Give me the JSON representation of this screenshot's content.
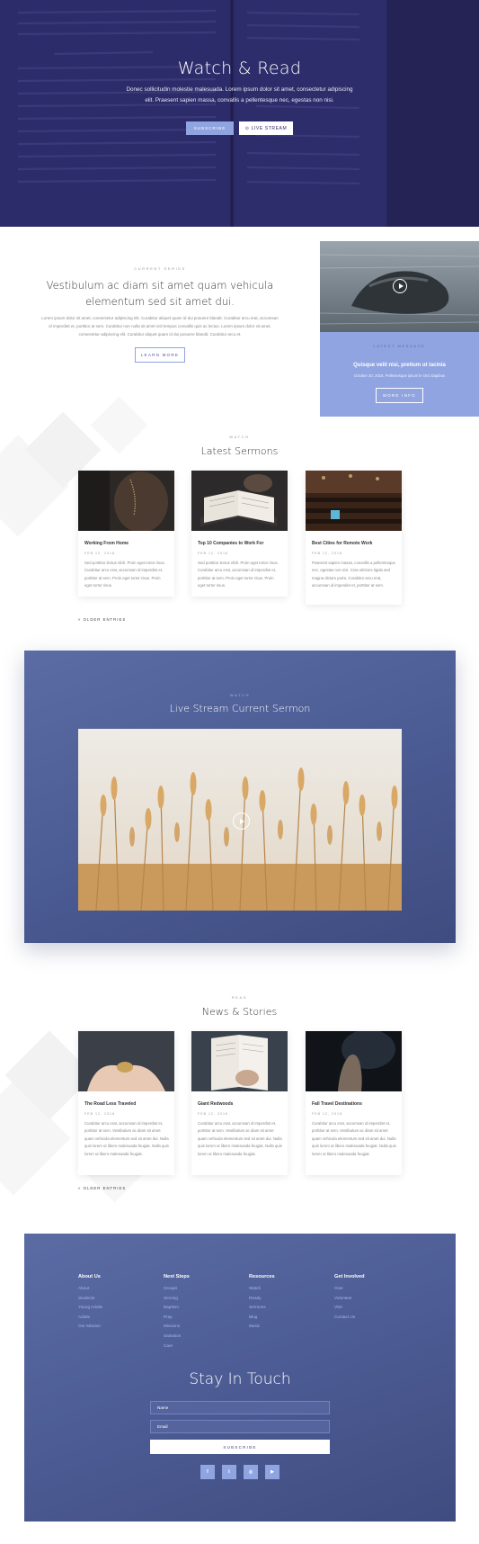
{
  "hero": {
    "title": "Watch & Read",
    "text": "Donec sollicitudin molestie malesuada. Lorem ipsum dolor sit amet, consectetur adipiscing elit. Praesent sapien massa, convallis a pellentesque nec, egestas non nisi.",
    "subscribe_label": "SUBSCRIBE",
    "live_label": "LIVE STREAM",
    "bg_color": "#2b2a66"
  },
  "series": {
    "eyebrow": "CURRENT SERIES",
    "title": "Vestibulum ac diam sit amet quam vehicula elementum sed sit amet dui.",
    "text": "Lorem ipsum dolor sit amet, consectetur adipiscing elit. Curabitur aliquet quam id dui posuere blandit. Curabitur arcu erat, accumsan id imperdiet et, porttitor at sem. Curabitur non nulla sit amet nisl tempus convallis quis ac lectus. Lorem ipsum dolor sit amet, consectetur adipiscing elit. Curabitur aliquet quam id dui posuere blandit. Curabitur arcu et.",
    "button_label": "LEARN MORE"
  },
  "latest_message": {
    "eyebrow": "LATEST MESSAGE",
    "title": "Quisque velit nisi, pretium ut lacinia",
    "subtitle": "October 20, 2018, Pellentesque ipsum le Orci Dapibus",
    "button_label": "MORE INFO",
    "accent": "#8fa4e0"
  },
  "sermons": {
    "eyebrow": "WATCH",
    "title": "Latest Sermons",
    "older_label": "« OLDER ENTRIES",
    "cards": [
      {
        "title": "Working From Home",
        "date": "FEB 12, 2018",
        "text": "Sed porttitor lectus nibh. Proin eget tortor risus. Curabitur arcu erat, accumsan id imperdiet et, porttitor at sem. Proin eget tortor risus. Proin eget tortor risus."
      },
      {
        "title": "Top 10 Companies to Work For",
        "date": "FEB 12, 2018",
        "text": "Sed porttitor lectus nibh. Proin eget tortor risus. Curabitur arcu erat, accumsan id imperdiet et, porttitor at sem. Proin eget tortor risus. Proin eget tortor risus."
      },
      {
        "title": "Best Cities for Remote Work",
        "date": "FEB 12, 2018",
        "text": "Praesent sapien massa, convallis a pellentesque nec, egestas non nisi. Cras ultricies ligula sed magna dictum porta. Curabitur arcu erat, accumsan id imperdiet et, porttitor at sem."
      }
    ]
  },
  "live": {
    "eyebrow": "WATCH",
    "title": "Live Stream Current Sermon"
  },
  "news": {
    "eyebrow": "READ",
    "title": "News & Stories",
    "older_label": "« OLDER ENTRIES",
    "cards": [
      {
        "title": "The Road Less Traveled",
        "date": "FEB 12, 2018",
        "text": "Curabitur arcu erat, accumsan id imperdiet et, porttitor at sem. Vestibulum ac diam sit amet quam vehicula elementum sed sit amet dui. Nulla quis lorem ut libero malesuada feugiat. Nulla quis lorem ut libero malesuada feugiat."
      },
      {
        "title": "Giant Redwoods",
        "date": "FEB 12, 2018",
        "text": "Curabitur arcu erat, accumsan id imperdiet et, porttitor at sem. Vestibulum ac diam sit amet quam vehicula elementum sed sit amet dui. Nulla quis lorem ut libero malesuada feugiat. Nulla quis lorem ut libero malesuada feugiat."
      },
      {
        "title": "Fall Travel Destinations",
        "date": "FEB 12, 2018",
        "text": "Curabitur arcu erat, accumsan id imperdiet et, porttitor at sem. Vestibulum ac diam sit amet quam vehicula elementum sed sit amet dui. Nulla quis lorem ut libero malesuada feugiat. Nulla quis lorem ut libero malesuada feugiat."
      }
    ]
  },
  "footer": {
    "columns": [
      {
        "title": "About Us",
        "items": [
          "About",
          "Students",
          "Young Adults",
          "Adults",
          "Our Mission"
        ]
      },
      {
        "title": "Next Steps",
        "items": [
          "Groups",
          "Serving",
          "Baptism",
          "Pray",
          "Missions",
          "Salvation",
          "Care"
        ]
      },
      {
        "title": "Resources",
        "items": [
          "Watch",
          "Ready",
          "Sermons",
          "Blog",
          "Music"
        ]
      },
      {
        "title": "Get Involved",
        "items": [
          "Give",
          "Volunteer",
          "Visit",
          "Contact Us"
        ]
      }
    ],
    "stay_title": "Stay In Touch",
    "name_placeholder": "Name",
    "email_placeholder": "Email",
    "subscribe_label": "SUBSCRIBE",
    "social": [
      {
        "icon": "facebook-icon",
        "glyph": "f"
      },
      {
        "icon": "twitter-icon",
        "glyph": "t"
      },
      {
        "icon": "instagram-icon",
        "glyph": "◎"
      },
      {
        "icon": "youtube-icon",
        "glyph": "▶"
      }
    ]
  }
}
